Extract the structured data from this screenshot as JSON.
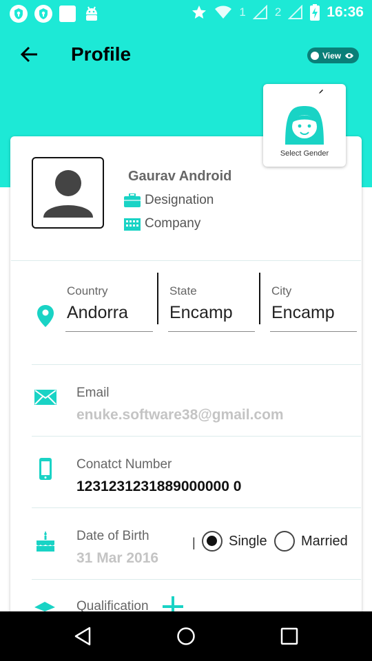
{
  "status_bar": {
    "sim1": "1",
    "sim2": "2",
    "time": "16:36"
  },
  "app_bar": {
    "title": "Profile",
    "view_toggle_label": "View"
  },
  "gender": {
    "label": "Select Gender"
  },
  "profile": {
    "name": "Gaurav Android",
    "designation": "Designation",
    "company": "Company"
  },
  "location": {
    "country_label": "Country",
    "country_value": "Andorra",
    "state_label": "State",
    "state_value": "Encamp",
    "city_label": "City",
    "city_value": "Encamp"
  },
  "email": {
    "label": "Email",
    "value": "enuke.software38@gmail.com"
  },
  "contact": {
    "label": "Conatct Number",
    "value": "1231231231889000000 0"
  },
  "dob": {
    "label": "Date of Birth",
    "value": "31 Mar 2016",
    "separator": "|"
  },
  "marital_status": {
    "options": [
      "Single",
      "Married"
    ],
    "selected": "Single"
  },
  "qualification": {
    "label": "Qualification"
  },
  "colors": {
    "accent": "#1de9d6",
    "icon": "#19d3c5"
  }
}
